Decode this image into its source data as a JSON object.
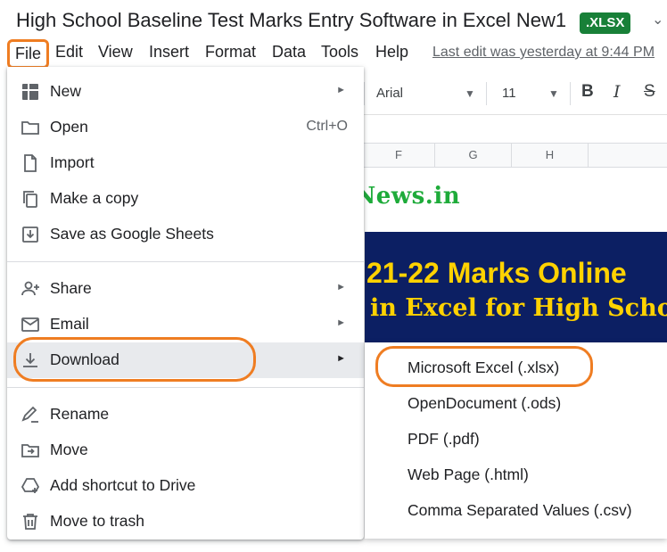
{
  "document": {
    "title": "High School Baseline Test Marks Entry Software in Excel New1",
    "format_badge": ".XLSX"
  },
  "menubar": {
    "items": [
      "File",
      "Edit",
      "View",
      "Insert",
      "Format",
      "Data",
      "Tools",
      "Help"
    ],
    "last_edit": "Last edit was yesterday at 9:44 PM"
  },
  "toolbar": {
    "font": "Arial",
    "font_size": "11",
    "bold": "B",
    "italic": "I",
    "strikethrough": "S"
  },
  "sheet": {
    "columns": [
      "F",
      "G",
      "H"
    ],
    "watermark": "www.teacherNews.in",
    "banner_line1": "21-22 Marks Online",
    "banner_line2": "in Excel for High Scho"
  },
  "file_menu": {
    "new": "New",
    "open": "Open",
    "open_shortcut": "Ctrl+O",
    "import": "Import",
    "make_copy": "Make a copy",
    "save_as_sheets": "Save as Google Sheets",
    "share": "Share",
    "email": "Email",
    "download": "Download",
    "rename": "Rename",
    "move": "Move",
    "add_shortcut": "Add shortcut to Drive",
    "move_to_trash": "Move to trash"
  },
  "download_submenu": {
    "items": [
      "Microsoft Excel (.xlsx)",
      "OpenDocument (.ods)",
      "PDF (.pdf)",
      "Web Page (.html)",
      "Comma Separated Values (.csv)"
    ]
  },
  "colors": {
    "highlight": "#ef7d22",
    "badge": "#188038",
    "watermark": "#1eab3a",
    "banner_bg": "#0c1f63",
    "banner_text": "#ffd200"
  }
}
